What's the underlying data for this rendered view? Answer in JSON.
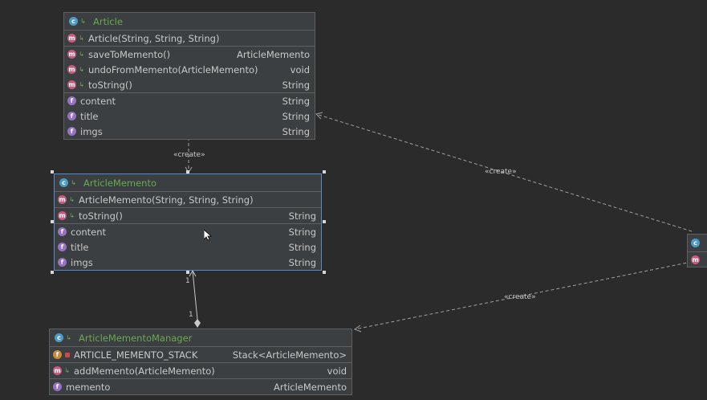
{
  "colors": {
    "background": "#2b2b2b",
    "box": "#3c3f41",
    "border": "#5e6060",
    "class_name": "#6aa84f",
    "selection": "#5a89c8",
    "edge": "#a0a0a0"
  },
  "icons": {
    "class": "class-icon",
    "method": "method-icon",
    "field": "field-icon",
    "static_field": "static-field-icon",
    "public": "public-visibility-icon",
    "private": "private-visibility-icon"
  },
  "article": {
    "name": "Article",
    "constructors": [
      {
        "name": "Article(String, String, String)",
        "type": ""
      }
    ],
    "methods": [
      {
        "name": "saveToMemento()",
        "type": "ArticleMemento"
      },
      {
        "name": "undoFromMemento(ArticleMemento)",
        "type": "void"
      },
      {
        "name": "toString()",
        "type": "String"
      }
    ],
    "fields": [
      {
        "name": "content",
        "type": "String"
      },
      {
        "name": "title",
        "type": "String"
      },
      {
        "name": "imgs",
        "type": "String"
      }
    ]
  },
  "memento": {
    "name": "ArticleMemento",
    "constructors": [
      {
        "name": "ArticleMemento(String, String, String)",
        "type": ""
      }
    ],
    "methods": [
      {
        "name": "toString()",
        "type": "String"
      }
    ],
    "fields": [
      {
        "name": "content",
        "type": "String"
      },
      {
        "name": "title",
        "type": "String"
      },
      {
        "name": "imgs",
        "type": "String"
      }
    ]
  },
  "manager": {
    "name": "ArticleMementoManager",
    "static_fields": [
      {
        "name": "ARTICLE_MEMENTO_STACK",
        "type": "Stack<ArticleMemento>"
      }
    ],
    "methods": [
      {
        "name": "addMemento(ArticleMemento)",
        "type": "void"
      }
    ],
    "fields": [
      {
        "name": "memento",
        "type": "ArticleMemento"
      }
    ]
  },
  "edges": {
    "create_label": "«create»",
    "mult_top": "1",
    "mult_bottom": "1"
  }
}
